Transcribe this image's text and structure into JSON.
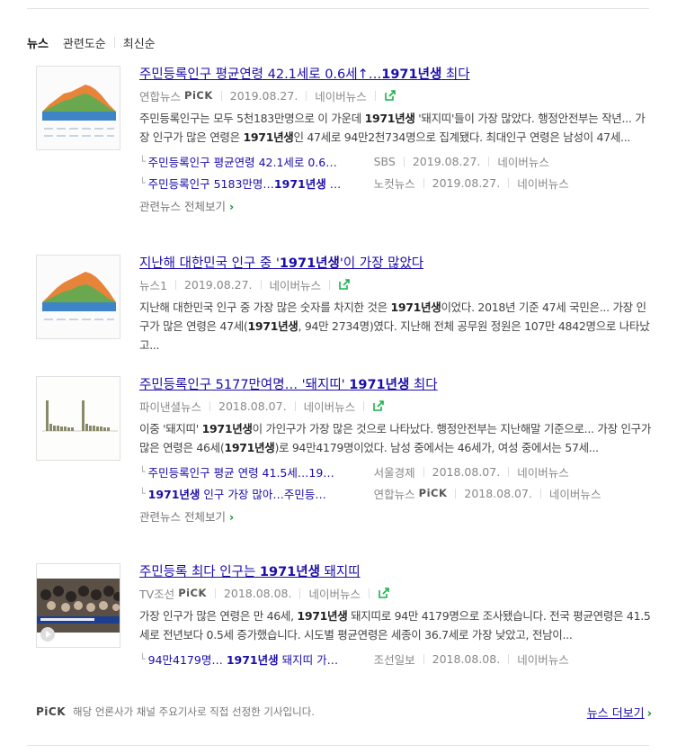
{
  "tabs": [
    {
      "label": "뉴스"
    },
    {
      "label": "관련도순"
    },
    {
      "label": "최신순"
    }
  ],
  "items": [
    {
      "title_pre": "주민등록인구 평균연령 42.1세로 0.6세↑…",
      "title_bold": "1971년생",
      "title_post": " 최다",
      "source": "연합뉴스",
      "pick": "PiCK",
      "date": "2019.08.27.",
      "portal": "네이버뉴스",
      "desc_parts": [
        "주민등록인구는 모두 5천183만명으로 이 가운데 ",
        "1971년생",
        " '돼지띠'들이 가장 많았다. 행정안전부는 작년... 가장 인구가 많은 연령은 ",
        "1971년생",
        "인 47세로 94만2천734명으로 집계됐다. 최대인구 연령은 남성이 47세..."
      ],
      "related": [
        {
          "title": "주민등록인구 평균연령 42.1세로 0.6…",
          "source": "SBS",
          "date": "2019.08.27.",
          "portal": "네이버뉴스"
        },
        {
          "title_pre": "주민등록인구 5183만명…",
          "title_bold": "1971년생",
          "title_post": " …",
          "source": "노컷뉴스",
          "date": "2019.08.27.",
          "portal": "네이버뉴스"
        }
      ],
      "all_related": "관련뉴스 전체보기"
    },
    {
      "title_pre": "지난해 대한민국 인구 중 '",
      "title_bold": "1971년생",
      "title_post": "'이 가장 많았다",
      "source": "뉴스1",
      "date": "2019.08.27.",
      "portal": "네이버뉴스",
      "desc_parts": [
        "지난해 대한민국 인구 중 가장 많은 숫자를 차지한 것은 ",
        "1971년생",
        "이었다. 2018년 기준 47세 국민은... 가장 인구가 많은 연령은 47세(",
        "1971년생",
        ", 94만 2734명)였다. 지난해 전체 공무원 정원은 107만 4842명으로 나타났고..."
      ]
    },
    {
      "title_pre": "주민등록인구 5177만여명… '돼지띠' ",
      "title_bold": "1971년생",
      "title_post": " 최다",
      "source": "파이낸셜뉴스",
      "date": "2018.08.07.",
      "portal": "네이버뉴스",
      "desc_parts": [
        "이중 '돼지띠' ",
        "1971년생",
        "이 가인구가 가장 많은 것으로 나타났다. 행정안전부는 지난해말 기준으로... 가장 인구가 많은 연령은 46세(",
        "1971년생",
        ")로 94만4179명이었다. 남성 중에서는 46세가, 여성 중에서는 57세..."
      ],
      "related": [
        {
          "title": "주민등록인구 평균 연령 41.5세…19…",
          "source": "서울경제",
          "date": "2018.08.07.",
          "portal": "네이버뉴스"
        },
        {
          "title_bold": "1971년생",
          "title_post": " 인구 가장 많아…주민등…",
          "source": "연합뉴스",
          "pick": "PiCK",
          "date": "2018.08.07.",
          "portal": "네이버뉴스"
        }
      ],
      "all_related": "관련뉴스 전체보기"
    },
    {
      "title_pre": "주민등록 최다 인구는 ",
      "title_bold": "1971년생",
      "title_post": " 돼지띠",
      "source": "TV조선",
      "pick": "PiCK",
      "date": "2018.08.08.",
      "portal": "네이버뉴스",
      "desc_parts": [
        "가장 인구가 많은 연령은 만 46세, ",
        "1971년생",
        " 돼지띠로 94만 4179명으로 조사됐습니다. 전국 평균연령은 41.5세로 전년보다 0.5세 증가했습니다. 시도별 평균연령은 세종이 36.7세로 가장 낮았고, 전남이..."
      ],
      "related": [
        {
          "title_pre": "94만4179명… ",
          "title_bold": "1971년생",
          "title_post": " 돼지띠 가…",
          "source": "조선일보",
          "date": "2018.08.08.",
          "portal": "네이버뉴스"
        }
      ]
    }
  ],
  "footer": {
    "pick_logo": "PiCK",
    "notice": "해당 언론사가 채널 주요기사로 직접 선정한 기사입니다.",
    "more": "뉴스 더보기"
  },
  "colors": {
    "link": "#1a0dab",
    "accent_green": "#0a8f2e"
  }
}
